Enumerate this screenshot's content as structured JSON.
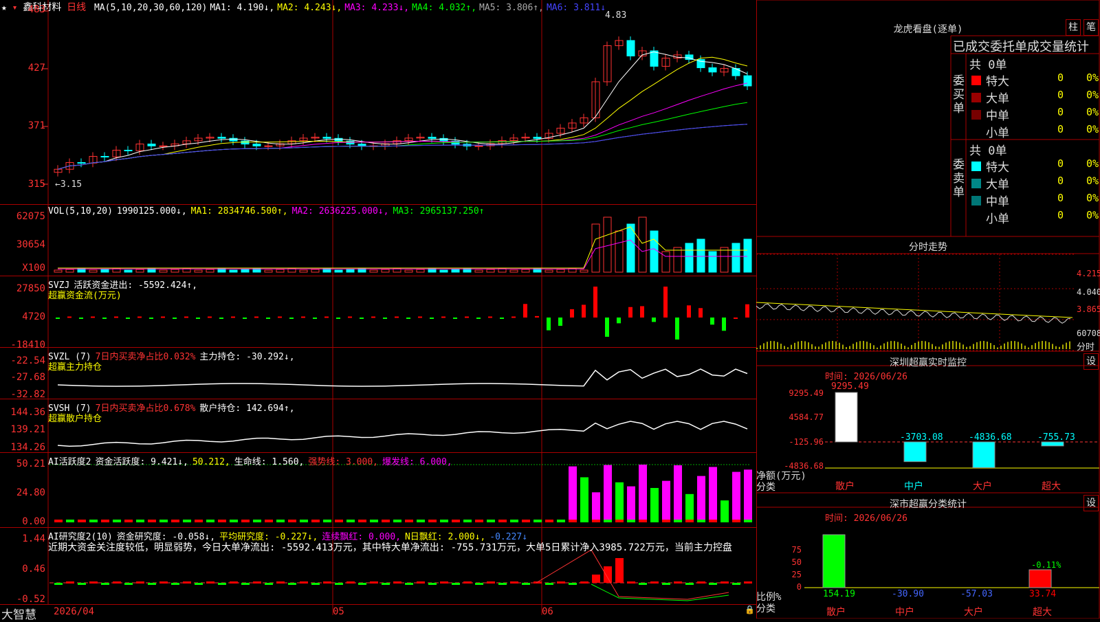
{
  "stock": {
    "name": "鑫科材料",
    "period": "日线"
  },
  "main_chart": {
    "ma_legend": [
      {
        "text": "MA(5,10,20,30,60,120)",
        "color": "#ffffff"
      },
      {
        "text": "MA1: 4.190↓,",
        "color": "#ffffff"
      },
      {
        "text": "MA2: 4.243↓,",
        "color": "#ffff00"
      },
      {
        "text": "MA3: 4.233↓,",
        "color": "#ff00ff"
      },
      {
        "text": "MA4: 4.032↑,",
        "color": "#00ff00"
      },
      {
        "text": "MA5: 3.806↑,",
        "color": "#aaaaaa"
      },
      {
        "text": "MA6: 3.811↓",
        "color": "#4444ff"
      }
    ],
    "y_ticks": [
      "483",
      "427",
      "371",
      "315"
    ],
    "low_marker": "←3.15",
    "high_marker": "4.83"
  },
  "vol": {
    "legend": [
      {
        "text": "VOL(5,10,20)",
        "color": "#ffffff"
      },
      {
        "text": "1990125.000↓,",
        "color": "#ffffff"
      },
      {
        "text": "MA1: 2834746.500↑,",
        "color": "#ffff00"
      },
      {
        "text": "MA2: 2636225.000↓,",
        "color": "#ff00ff"
      },
      {
        "text": "MA3: 2965137.250↑",
        "color": "#00ff00"
      }
    ],
    "y_ticks": [
      "62075",
      "30654",
      "X100"
    ]
  },
  "svzj": {
    "legend": [
      {
        "text": "SVZJ",
        "color": "#ffffff"
      },
      {
        "text": "活跃资金进出: -5592.424↑,",
        "color": "#ffffff"
      }
    ],
    "sub": "超赢资金流(万元)",
    "y_ticks": [
      "27850",
      "4720",
      "-18410"
    ]
  },
  "svzl": {
    "legend": [
      {
        "text": "SVZL (7)",
        "color": "#ffffff"
      },
      {
        "text": "7日内买卖净占比0.032%",
        "color": "#ff3333"
      },
      {
        "text": "主力持仓: -30.292↓,",
        "color": "#ffffff"
      }
    ],
    "sub": "超赢主力持仓",
    "y_ticks": [
      "-22.54",
      "-27.68",
      "-32.82"
    ]
  },
  "svsh": {
    "legend": [
      {
        "text": "SVSH (7)",
        "color": "#ffffff"
      },
      {
        "text": "7日内买卖净占比0.678%",
        "color": "#ff3333"
      },
      {
        "text": "散户持仓: 142.694↑,",
        "color": "#ffffff"
      }
    ],
    "sub": "超赢散户持仓",
    "y_ticks": [
      "144.36",
      "139.21",
      "134.26"
    ]
  },
  "active": {
    "legend": [
      {
        "text": "AI活跃度2",
        "color": "#ffffff"
      },
      {
        "text": "资金活跃度: 9.421↓,",
        "color": "#ffffff"
      },
      {
        "text": "50.212,",
        "color": "#ffff00"
      },
      {
        "text": "生命线: 1.560,",
        "color": "#ffffff"
      },
      {
        "text": "强势线: 3.000,",
        "color": "#ff3333"
      },
      {
        "text": "爆发线: 6.000,",
        "color": "#ff00ff"
      }
    ],
    "y_ticks": [
      "50.21",
      "24.80",
      "0.00"
    ]
  },
  "research": {
    "legend": [
      {
        "text": "AI研究度2(10)",
        "color": "#ffffff"
      },
      {
        "text": "资金研究度: -0.058↓,",
        "color": "#ffffff"
      },
      {
        "text": "平均研究度: -0.227↓,",
        "color": "#ffff00"
      },
      {
        "text": "连续飘红: 0.000,",
        "color": "#ff00ff"
      },
      {
        "text": "N日飘红: 2.000↓,",
        "color": "#ffff00"
      },
      {
        "text": "-0.227↓",
        "color": "#4488ff"
      }
    ],
    "comment": "近期大资金关注度较低，明显弱势，今日大单净流出: -5592.413万元，其中特大单净流出: -755.731万元，大单5日累计净入3985.722万元，当前主力控盘",
    "y_ticks": [
      "1.44",
      "0.46",
      "-0.52"
    ]
  },
  "bottom": {
    "brand": "大智慧",
    "dates": [
      "2026/04",
      "05",
      "06"
    ]
  },
  "longhu": {
    "title": "龙虎看盘(逐单)",
    "btn_bar": "柱",
    "btn_detail": "笔",
    "subtitle": "已成交委托单成交量统计",
    "buy_label": "委买单",
    "sell_label": "委卖单",
    "buy_total": "共 0单",
    "sell_total": "共 0单",
    "buy_rows": [
      {
        "name": "特大",
        "value": "0",
        "pct": "0%",
        "color": "#ff0000"
      },
      {
        "name": "大单",
        "value": "0",
        "pct": "0%",
        "color": "#990000"
      },
      {
        "name": "中单",
        "value": "0",
        "pct": "0%",
        "color": "#770000"
      },
      {
        "name": "小单",
        "value": "0",
        "pct": "0%",
        "color": "#000000"
      }
    ],
    "sell_rows": [
      {
        "name": "特大",
        "value": "0",
        "pct": "0%",
        "color": "#00ffff"
      },
      {
        "name": "大单",
        "value": "0",
        "pct": "0%",
        "color": "#008888"
      },
      {
        "name": "中单",
        "value": "0",
        "pct": "0%",
        "color": "#007777"
      },
      {
        "name": "小单",
        "value": "0",
        "pct": "0%",
        "color": "#000000"
      }
    ]
  },
  "fenshi": {
    "title": "分时走势",
    "prices": [
      "4.215",
      "4.040",
      "3.865"
    ],
    "vol_label": "60708",
    "footer": "分时"
  },
  "sz_monitor": {
    "title": "深圳超赢实时监控",
    "settings": "设",
    "time": "时间: 2026/06/26",
    "y_ticks": [
      "9295.49",
      "4584.77",
      "-125.96",
      "-4836.68"
    ],
    "bars": [
      {
        "label": "散户",
        "value": "9295.49",
        "v": 9295.49,
        "color": "#ffffff"
      },
      {
        "label": "中户",
        "value": "-3703.08",
        "v": -3703.08,
        "color": "#00ffff"
      },
      {
        "label": "大户",
        "value": "-4836.68",
        "v": -4836.68,
        "color": "#00ffff"
      },
      {
        "label": "超大",
        "value": "-755.73",
        "v": -755.73,
        "color": "#00ffff"
      }
    ],
    "net_label": "净额(万元)",
    "cat_label": "分类"
  },
  "sz_class": {
    "title": "深市超赢分类统计",
    "settings": "设",
    "time": "时间: 2026/06/26",
    "y_ticks": [
      "75",
      "50",
      "25",
      "0"
    ],
    "bars": [
      {
        "label": "散户",
        "value": "154.19",
        "v": 154.19,
        "color": "#00ff00"
      },
      {
        "label": "中户",
        "value": "-30.90",
        "v": -30.9,
        "color": "#0000ff"
      },
      {
        "label": "大户",
        "value": "-57.03",
        "v": -57.03,
        "color": "#0000ff"
      },
      {
        "label": "超大",
        "value": "33.74",
        "v": 33.74,
        "color": "#ff0000"
      }
    ],
    "top_label": "-0.11%",
    "ratio_label": "比例%",
    "cat_label": "分类"
  }
}
